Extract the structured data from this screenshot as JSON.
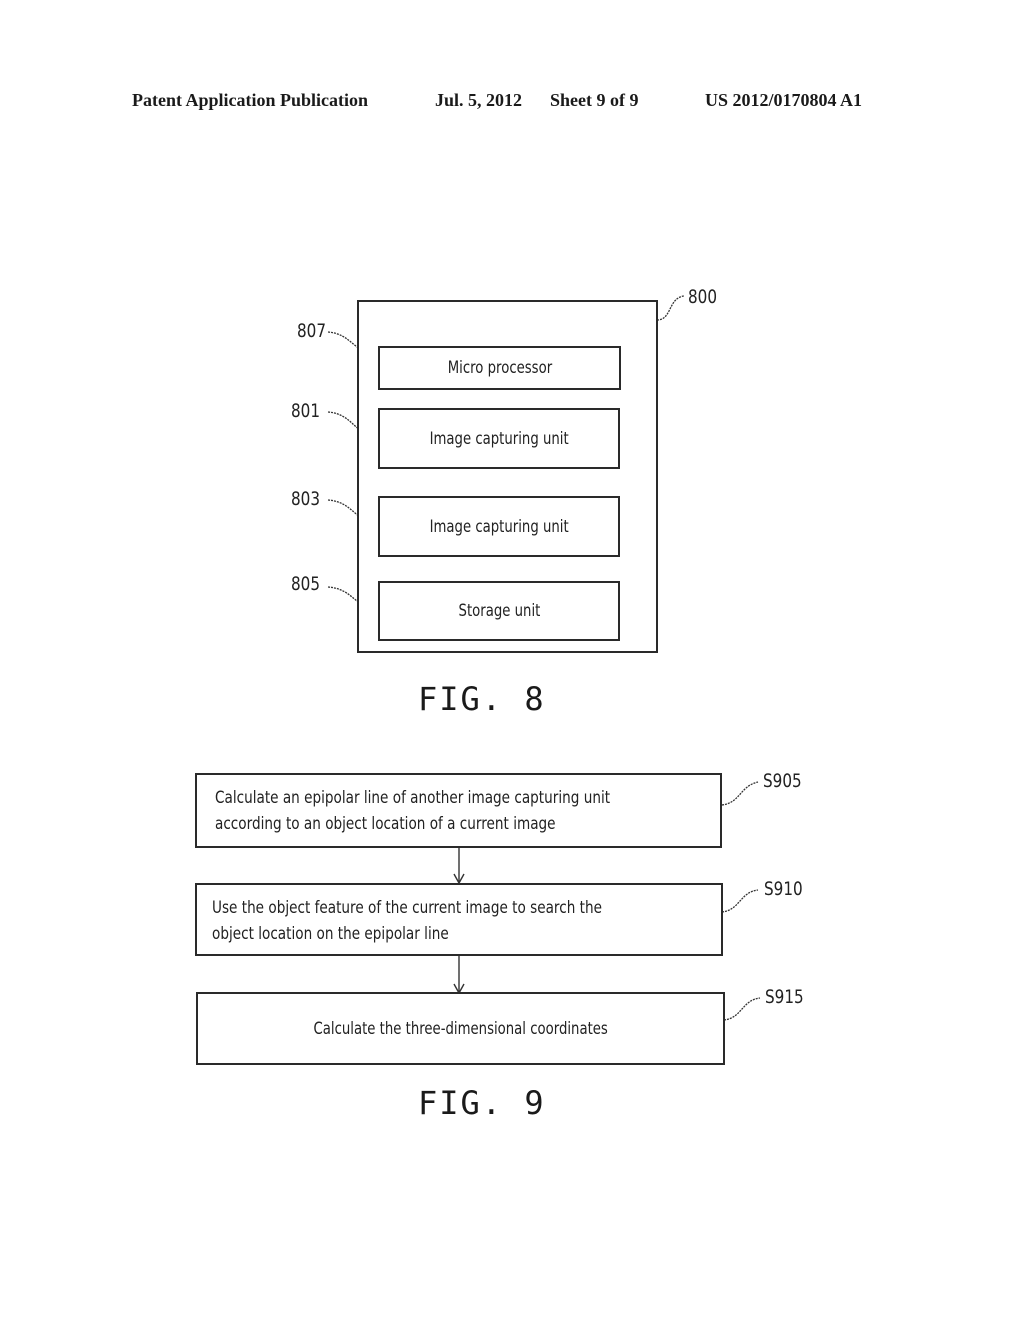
{
  "header": {
    "publication": "Patent Application Publication",
    "date": "Jul. 5, 2012",
    "sheet": "Sheet 9 of 9",
    "number": "US 2012/0170804 A1"
  },
  "fig8": {
    "caption": "FIG. 8",
    "container_ref": "800",
    "blocks": [
      {
        "ref": "807",
        "label": "Micro processor"
      },
      {
        "ref": "801",
        "label": "Image capturing unit"
      },
      {
        "ref": "803",
        "label": "Image capturing unit"
      },
      {
        "ref": "805",
        "label": "Storage unit"
      }
    ]
  },
  "fig9": {
    "caption": "FIG. 9",
    "steps": [
      {
        "ref": "S905",
        "lines": [
          "Calculate an epipolar line of another image capturing unit",
          "according to an object location of a current image"
        ]
      },
      {
        "ref": "S910",
        "lines": [
          "Use the object feature of the current image to search the",
          "object location on the epipolar line"
        ]
      },
      {
        "ref": "S915",
        "lines": [
          "Calculate the three-dimensional coordinates"
        ]
      }
    ]
  }
}
